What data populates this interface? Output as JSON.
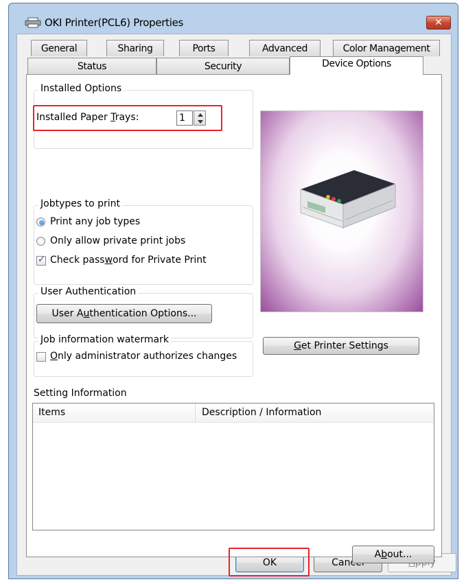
{
  "window": {
    "title": "OKI Printer(PCL6) Properties",
    "close_glyph": "✕"
  },
  "tabs": {
    "row_top": [
      {
        "label": "General"
      },
      {
        "label": "Sharing"
      },
      {
        "label": "Ports"
      },
      {
        "label": "Advanced"
      },
      {
        "label": "Color Management"
      }
    ],
    "row_bottom": [
      {
        "label": "Status"
      },
      {
        "label": "Security"
      },
      {
        "label": "Device Options",
        "active": true
      }
    ]
  },
  "installed_options": {
    "legend": "Installed Options",
    "trays_label_pre": "Installed Paper ",
    "trays_label_key": "T",
    "trays_label_post": "rays:",
    "trays_value": "1"
  },
  "jobtypes": {
    "legend_key": "J",
    "legend_rest": "obtypes to print",
    "radio_any": "Print any job types",
    "radio_private": "Only allow private print jobs",
    "check_password_pre": "Check pass",
    "check_password_key": "w",
    "check_password_post": "ord for Private Print",
    "check_password_checked": true
  },
  "user_auth": {
    "legend": "User Authentication",
    "button_pre": "User A",
    "button_key": "u",
    "button_post": "thentication Options..."
  },
  "watermark": {
    "legend": "Job information watermark",
    "check_key": "O",
    "check_rest": "nly administrator authorizes changes",
    "checked": false
  },
  "get_settings": {
    "key": "G",
    "rest": "et Printer Settings"
  },
  "setting_info": {
    "title": "Setting Information",
    "col_items": "Items",
    "col_desc": "Description / Information"
  },
  "about": {
    "pre": "A",
    "key": "b",
    "post": "out..."
  },
  "footer": {
    "ok": "OK",
    "cancel": "Cancel",
    "apply_key": "A",
    "apply_rest": "pply"
  },
  "colors": {
    "highlight": "#e8232b",
    "title_bar": "#b9d1ea",
    "close_button": "#c8452d",
    "image_gradient": "#9a4e9d"
  },
  "icons": {
    "title": "printer-icon",
    "close": "close-icon",
    "spinner_up": "arrow-up-icon",
    "spinner_down": "arrow-down-icon"
  }
}
